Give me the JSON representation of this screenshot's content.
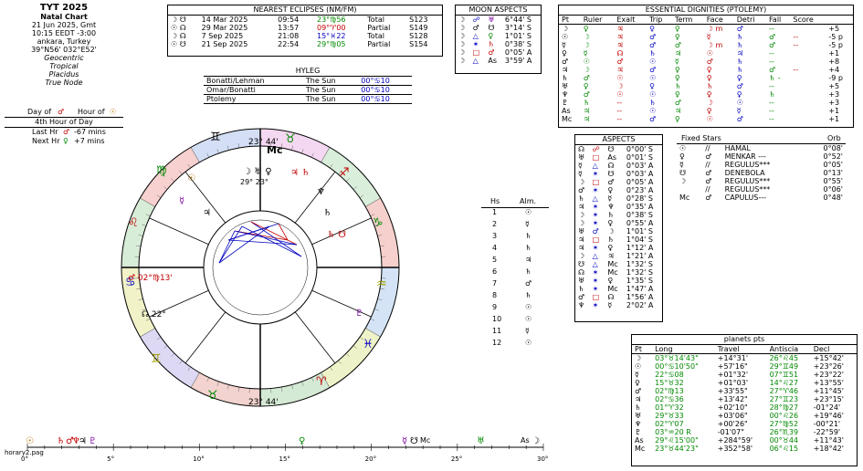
{
  "title": {
    "name": "TYT 2025",
    "lines": [
      "Natal Chart",
      "21 Jun 2025, Gmt",
      "10:15  EEDT -3:00",
      "ankara, Turkey",
      "39°N56' 032°E52'",
      "Geocentric",
      "Tropical",
      "Placidus",
      "True Node"
    ]
  },
  "hour": {
    "day_of_label": "Day of",
    "hour_of_label": "Hour of",
    "hour_of_day": "4th Hour of Day",
    "last_hr": "Last Hr",
    "last_val": "-67 mins",
    "next_hr": "Next Hr",
    "next_val": "+7 mins"
  },
  "eclipses": {
    "title": "NEAREST ECLIPSES (NM/FM)",
    "rows": [
      {
        "date": "14 Mar 2025",
        "time": "09:54",
        "pos": "23°♍56",
        "type": "Total",
        "saros": "S123"
      },
      {
        "date": "29 Mar 2025",
        "time": "13:57",
        "pos": "09°♈00",
        "type": "Partial",
        "saros": "S149"
      },
      {
        "date": "7 Sep 2025",
        "time": "21:08",
        "pos": "15°♓22",
        "type": "Total",
        "saros": "S128"
      },
      {
        "date": "21 Sep 2025",
        "time": "22:54",
        "pos": "29°♍05",
        "type": "Partial",
        "saros": "S154"
      }
    ]
  },
  "moon_aspects": {
    "title": "MOON ASPECTS",
    "rows": [
      {
        "asp": "☍",
        "pl": "♅",
        "orb": "6°44' S"
      },
      {
        "asp": "♂",
        "pl": "☋",
        "orb": "3°14' S"
      },
      {
        "asp": "△",
        "pl": "♀",
        "orb": "1°01' S"
      },
      {
        "asp": "✶",
        "pl": "♄",
        "orb": "0°38' S"
      },
      {
        "asp": "□",
        "pl": "♂",
        "orb": "0°05' A"
      },
      {
        "asp": "△",
        "pl": "As",
        "orb": "3°59' A"
      }
    ]
  },
  "hyleg": {
    "title": "HYLEG",
    "rows": [
      {
        "method": "Bonatti/Lehman",
        "pl": "The Sun",
        "pos": "00°♋10"
      },
      {
        "method": "Omar/Bonatti",
        "pl": "The Sun",
        "pos": "00°♋10"
      },
      {
        "method": "Ptolemy",
        "pl": "The Sun",
        "pos": "00°♋10"
      }
    ]
  },
  "dignities": {
    "title": "ESSENTIAL DIGNITIES (PTOLEMY)",
    "headers": [
      "Pt",
      "Ruler",
      "Exalt",
      "Trip",
      "Term",
      "Face",
      "Detri",
      "Fall",
      "Score"
    ],
    "rows": [
      {
        "pt": "☽",
        "c": [
          "♀",
          "♃",
          "♀",
          "♀",
          "☽ m",
          "♂",
          "--",
          ""
        ],
        "score": "+5"
      },
      {
        "pt": "☉",
        "c": [
          "☽",
          "♃",
          "♂",
          "♀",
          "☿",
          "♄",
          "♂",
          "--"
        ],
        "score": "-5 p"
      },
      {
        "pt": "☿",
        "c": [
          "☽",
          "♃",
          "♂",
          "♂",
          "☽ m",
          "♄",
          "♂",
          "--"
        ],
        "score": "-5 p"
      },
      {
        "pt": "♀",
        "c": [
          "☿",
          "☊",
          "♄",
          "♃",
          "☉",
          "♃",
          "--",
          ""
        ],
        "score": "+1"
      },
      {
        "pt": "♂",
        "c": [
          "☉",
          "♂",
          "☉",
          "☿",
          "♂",
          "♄",
          "--",
          ""
        ],
        "score": "+8"
      },
      {
        "pt": "♃",
        "c": [
          "☽",
          "♃",
          "♂",
          "♀",
          "♀",
          "♄",
          "♂",
          "--"
        ],
        "score": "+4"
      },
      {
        "pt": "♄",
        "c": [
          "♂",
          "☉",
          "☉",
          "♀",
          "♀",
          "♀",
          "♄ -",
          ""
        ],
        "score": "-9 p"
      },
      {
        "pt": "♅",
        "c": [
          "♀",
          "☽",
          "♀",
          "♄",
          "♄",
          "♂",
          "--",
          ""
        ],
        "score": "+5"
      },
      {
        "pt": "♆",
        "c": [
          "♂",
          "☉",
          "☉",
          "♀",
          "♀",
          "♀",
          "♄",
          ""
        ],
        "score": "+3"
      },
      {
        "pt": "♇",
        "c": [
          "♄",
          "--",
          "♄",
          "♂",
          "☽",
          "☉",
          "--",
          ""
        ],
        "score": "+3"
      },
      {
        "pt": "As",
        "c": [
          "♃",
          "--",
          "☉",
          "♃",
          "♀",
          "☿",
          "--",
          ""
        ],
        "score": "+1"
      },
      {
        "pt": "Mc",
        "c": [
          "♃",
          "--",
          "♂",
          "♀",
          "☉",
          "♂",
          "--",
          ""
        ],
        "score": "+1"
      }
    ]
  },
  "aspects": {
    "title": "ASPECTS",
    "rows": [
      {
        "p1": "☊",
        "a": "☍",
        "p2": "☋",
        "orb": "0°00' S"
      },
      {
        "p1": "♅",
        "a": "□",
        "p2": "As",
        "orb": "0°01' S"
      },
      {
        "p1": "☿",
        "a": "△",
        "p2": "☊",
        "orb": "0°03' A"
      },
      {
        "p1": "☿",
        "a": "✶",
        "p2": "☋",
        "orb": "0°03' A"
      },
      {
        "p1": "☽",
        "a": "□",
        "p2": "♂",
        "orb": "0°05' A"
      },
      {
        "p1": "♂",
        "a": "✶",
        "p2": "♀",
        "orb": "0°23' A"
      },
      {
        "p1": "♄",
        "a": "△",
        "p2": "☿",
        "orb": "0°28' S"
      },
      {
        "p1": "♃",
        "a": "✶",
        "p2": "♆",
        "orb": "0°35' A"
      },
      {
        "p1": "☽",
        "a": "✶",
        "p2": "♄",
        "orb": "0°38' S"
      },
      {
        "p1": "☽",
        "a": "✶",
        "p2": "♀",
        "orb": "0°55' A"
      },
      {
        "p1": "♅",
        "a": "♂",
        "p2": "☽",
        "orb": "1°01' S"
      },
      {
        "p1": "♃",
        "a": "□",
        "p2": "♄",
        "orb": "1°04' S"
      },
      {
        "p1": "♃",
        "a": "✶",
        "p2": "♀",
        "orb": "1°12' A"
      },
      {
        "p1": "☽",
        "a": "△",
        "p2": "♃",
        "orb": "1°21' A"
      },
      {
        "p1": "☋",
        "a": "△",
        "p2": "Mc",
        "orb": "1°32' S"
      },
      {
        "p1": "☊",
        "a": "✶",
        "p2": "Mc",
        "orb": "1°32' S"
      },
      {
        "p1": "♅",
        "a": "✶",
        "p2": "♀",
        "orb": "1°35' S"
      },
      {
        "p1": "♄",
        "a": "✶",
        "p2": "Mc",
        "orb": "1°47' A"
      },
      {
        "p1": "♂",
        "a": "□",
        "p2": "☊",
        "orb": "1°56' A"
      },
      {
        "p1": "♆",
        "a": "✶",
        "p2": "☿",
        "orb": "2°02' A"
      }
    ]
  },
  "fixed_stars": {
    "title": "Fixed Stars",
    "orb_title": "Orb",
    "rows": [
      {
        "pt": "☉",
        "asp": "//",
        "star": "HAMAL",
        "orb": "0°08'"
      },
      {
        "pt": "♀",
        "asp": "♂",
        "star": "MENKAR ---",
        "orb": "0°52'"
      },
      {
        "pt": "☿",
        "asp": "//",
        "star": "REGULUS***",
        "orb": "0°05'"
      },
      {
        "pt": "☋",
        "asp": "♂",
        "star": "DENEBOLA",
        "orb": "0°13'"
      },
      {
        "pt": "☽",
        "asp": "♂",
        "star": "REGULUS***",
        "orb": "0°55'"
      },
      {
        "pt": "",
        "asp": "//",
        "star": "REGULUS***",
        "orb": "0°06'"
      },
      {
        "pt": "Mc",
        "asp": "♂",
        "star": "CAPULUS---",
        "orb": "0°48'"
      }
    ]
  },
  "houses": {
    "hs_title": "Hs",
    "alm_title": "Alm.",
    "rows": [
      {
        "h": "1",
        "alm": "☉"
      },
      {
        "h": "2",
        "alm": "☿"
      },
      {
        "h": "3",
        "alm": "♄"
      },
      {
        "h": "4",
        "alm": "♄"
      },
      {
        "h": "5",
        "alm": "♃"
      },
      {
        "h": "6",
        "alm": "♄"
      },
      {
        "h": "7",
        "alm": "♂"
      },
      {
        "h": "8",
        "alm": "♄"
      },
      {
        "h": "9",
        "alm": "☉"
      },
      {
        "h": "10",
        "alm": "☉"
      },
      {
        "h": "11",
        "alm": "☿"
      },
      {
        "h": "12",
        "alm": "☉"
      }
    ]
  },
  "planet_pts": {
    "title": "planets pts",
    "headers": [
      "Pt",
      "Long",
      "Travel",
      "Antiscia",
      "Decl"
    ],
    "rows": [
      {
        "pt": "☽",
        "long": "03°♉14'43\"",
        "travel": "+14°31'",
        "anti": "26°♌45",
        "decl": "+15°42'"
      },
      {
        "pt": "☉",
        "long": "00°♋10'50\"",
        "travel": "+57'16\"",
        "anti": "29°♊49",
        "decl": "+23°26'"
      },
      {
        "pt": "☿",
        "long": "22°♋08",
        "travel": "+01°32'",
        "anti": "07°♊51",
        "decl": "+23°22'"
      },
      {
        "pt": "♀",
        "long": "15°♉32",
        "travel": "+01°03'",
        "anti": "14°♌27",
        "decl": "+13°55'"
      },
      {
        "pt": "♂",
        "long": "02°♍13",
        "travel": "+33'55\"",
        "anti": "27°♈46",
        "decl": "+11°45'"
      },
      {
        "pt": "♃",
        "long": "02°♋36",
        "travel": "+13'42\"",
        "anti": "27°♊23",
        "decl": "+23°15'"
      },
      {
        "pt": "♄",
        "long": "01°♈32",
        "travel": "+02'10\"",
        "anti": "28°♍27",
        "decl": "-01°24'"
      },
      {
        "pt": "♅",
        "long": "29°♉33",
        "travel": "+03'06\"",
        "anti": "00°♌26",
        "decl": "+19°46'"
      },
      {
        "pt": "♆",
        "long": "02°♈07",
        "travel": "+00'26\"",
        "anti": "27°♍52",
        "decl": "-00°21'"
      },
      {
        "pt": "♇",
        "long": "03°♒20 R",
        "travel": "-01'07\"",
        "anti": "26°♏39",
        "decl": "-22°59'"
      },
      {
        "pt": "As",
        "long": "29°♌15'00\"",
        "travel": "+284°59'",
        "anti": "00°♉44",
        "decl": "+11°43'"
      },
      {
        "pt": "Mc",
        "long": "23°♉44'23\"",
        "travel": "+352°58'",
        "anti": "06°♌15",
        "decl": "+18°42'"
      }
    ]
  },
  "wheel": {
    "cusp_degrees": [
      "23°",
      "44'",
      "13°",
      "44'",
      "22°",
      "55'",
      "29°",
      "15'",
      "02°",
      "23°",
      "26°",
      "22°",
      "23°",
      "44'",
      "02°",
      "12°"
    ],
    "signs": [
      "♊",
      "♉",
      "♈",
      "♓",
      "♒",
      "♑",
      "♐",
      "♏",
      "♎",
      "♍",
      "♌",
      "♋"
    ],
    "filename": "horary2.pag"
  },
  "ruler": {
    "ticks": [
      "0°",
      "5°",
      "10°",
      "15°",
      "20°",
      "25°",
      "30°"
    ]
  },
  "colors": {
    "fire": "#c00000",
    "earth": "#008800",
    "air": "#a0a000",
    "water": "#0000c0"
  }
}
